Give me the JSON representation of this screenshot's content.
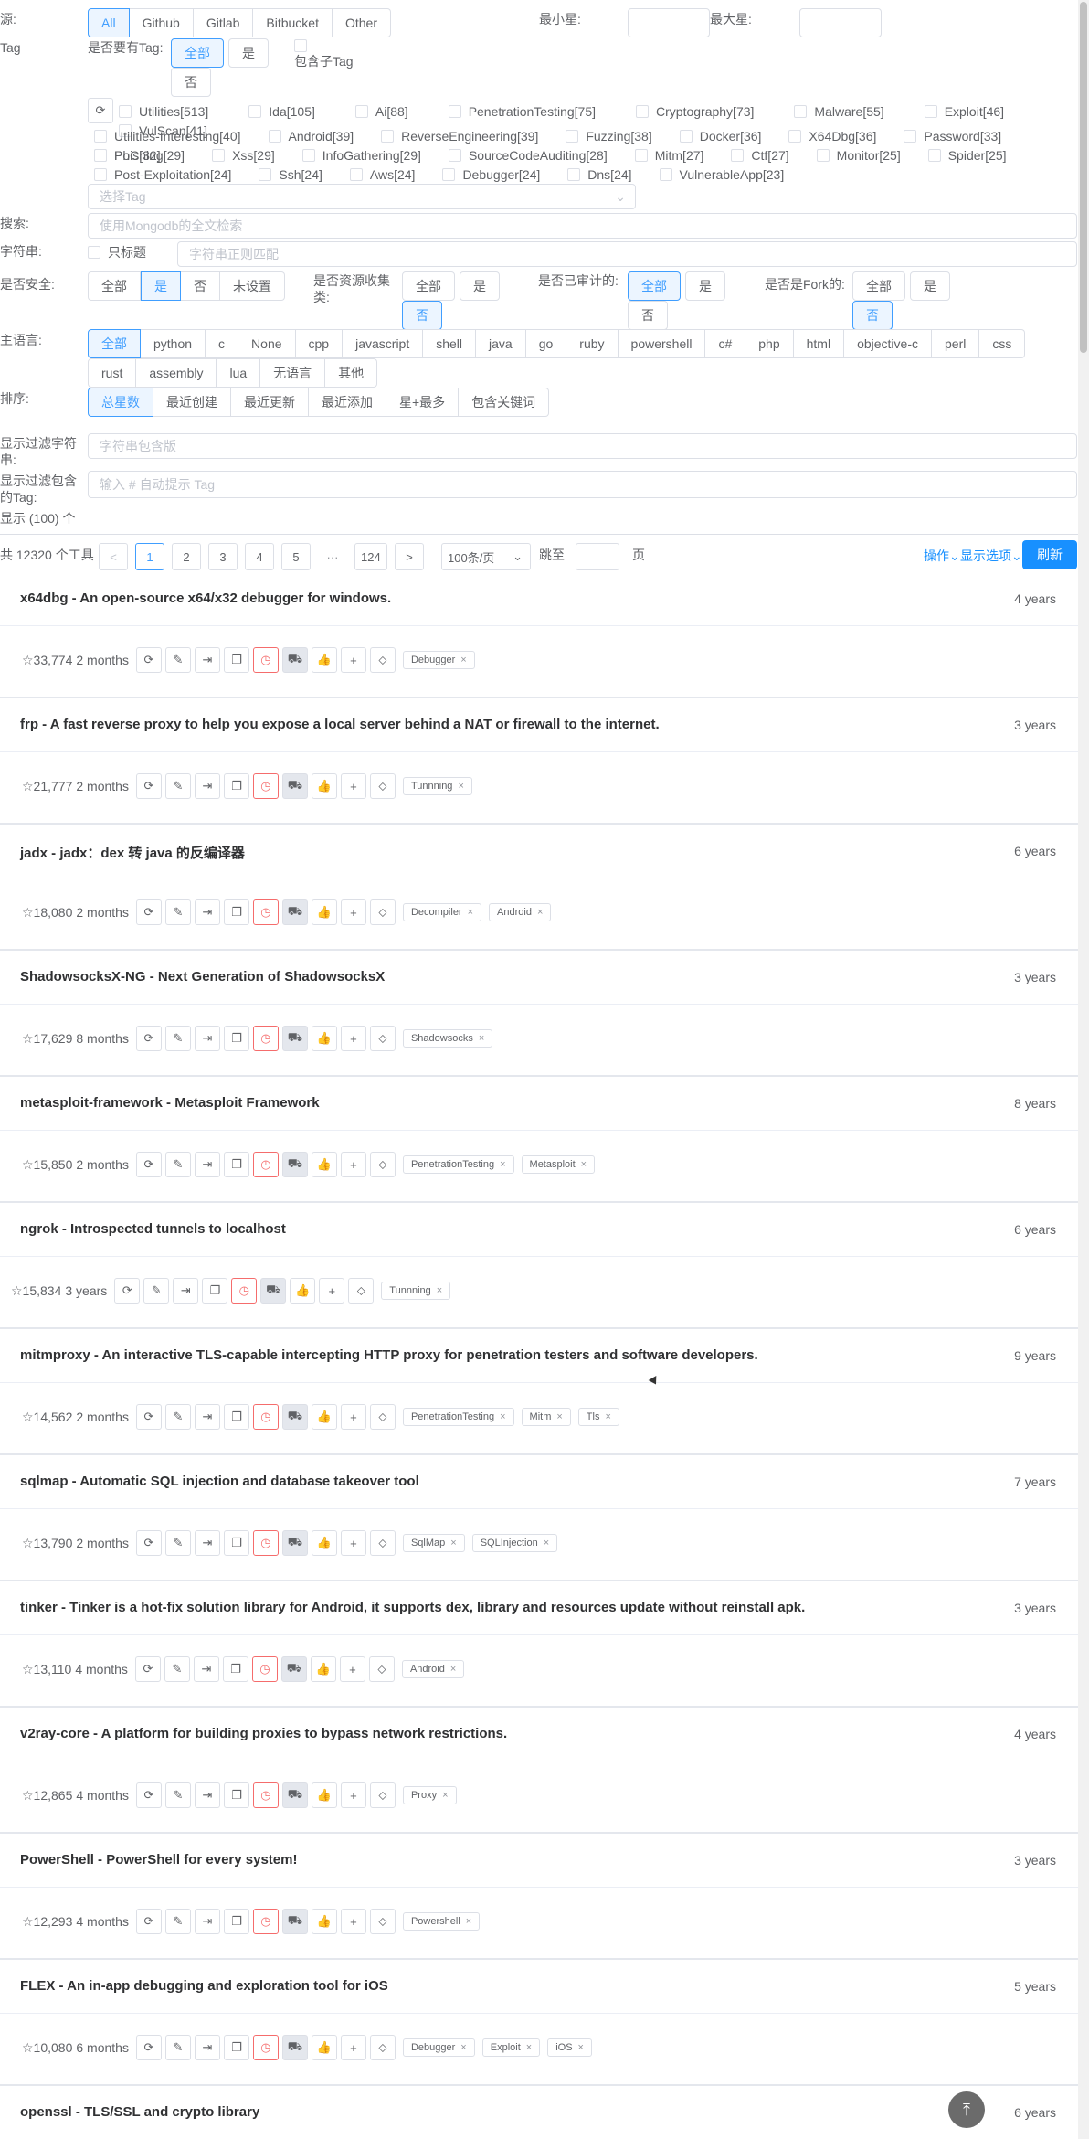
{
  "filters": {
    "source_label": "源:",
    "source_options": [
      "All",
      "Github",
      "Gitlab",
      "Bitbucket",
      "Other"
    ],
    "min_star_label": "最小星:",
    "max_star_label": "最大星:",
    "tag_label": "Tag",
    "has_tag_label": "是否要有Tag:",
    "has_tag_options": [
      "全部",
      "是",
      "否"
    ],
    "include_sub_label": "包含子Tag",
    "tags_row1": [
      "Utilities[513]",
      "Ida[105]",
      "Ai[88]",
      "PenetrationTesting[75]",
      "Cryptography[73]",
      "Malware[55]",
      "Exploit[46]",
      "VulScan[41]"
    ],
    "tags_row2": [
      "Utilities-Interesting[40]",
      "Android[39]",
      "ReverseEngineering[39]",
      "Fuzzing[38]",
      "Docker[36]",
      "X64Dbg[36]",
      "Password[33]",
      "PoC[32]"
    ],
    "tags_row3": [
      "Phishing[29]",
      "Xss[29]",
      "InfoGathering[29]",
      "SourceCodeAuditing[28]",
      "Mitm[27]",
      "Ctf[27]",
      "Monitor[25]",
      "Spider[25]"
    ],
    "tags_row4": [
      "Post-Exploitation[24]",
      "Ssh[24]",
      "Aws[24]",
      "Debugger[24]",
      "Dns[24]",
      "VulnerableApp[23]"
    ],
    "select_tag_placeholder": "选择Tag",
    "search_label": "搜索:",
    "search_placeholder": "使用Mongodb的全文检索",
    "string_label": "字符串:",
    "title_only_label": "只标题",
    "regex_placeholder": "字符串正则匹配",
    "safe_label": "是否安全:",
    "safe_options": [
      "全部",
      "是",
      "否",
      "未设置"
    ],
    "collect_label": "是否资源收集类:",
    "collect_options": [
      "全部",
      "是",
      "否"
    ],
    "audited_label": "是否已审计的:",
    "audited_options": [
      "全部",
      "是",
      "否"
    ],
    "fork_label": "是否是Fork的:",
    "fork_options": [
      "全部",
      "是",
      "否"
    ],
    "lang_label": "主语言:",
    "lang_row1": [
      "全部",
      "python",
      "c",
      "None",
      "cpp",
      "javascript",
      "shell",
      "java",
      "go",
      "ruby",
      "powershell",
      "c#",
      "php",
      "html",
      "objective-c",
      "perl",
      "css"
    ],
    "lang_row2": [
      "rust",
      "assembly",
      "lua",
      "无语言",
      "其他"
    ],
    "sort_label": "排序:",
    "sort_options": [
      "总星数",
      "最近创建",
      "最近更新",
      "最近添加",
      "星+最多",
      "包含关键词"
    ],
    "show_filter_label": "显示过滤字符串:",
    "show_filter_placeholder": "字符串包含版",
    "show_tag_label": "显示过滤包含的Tag:",
    "show_tag_placeholder": "输入 # 自动提示 Tag",
    "show_count": "显示 (100) 个"
  },
  "pager": {
    "total": "共 12320 个工具",
    "prev": "<",
    "pages": [
      "1",
      "2",
      "3",
      "4",
      "5"
    ],
    "ellipsis": "···",
    "last": "124",
    "next": ">",
    "per_page": "100条/页",
    "goto": "跳至",
    "page_unit": "页",
    "ops": "操作",
    "display": "显示选项",
    "refresh": "刷新"
  },
  "repos": [
    {
      "title": "x64dbg - An open-source x64/x32 debugger for windows.",
      "age": "4 years",
      "stars": "☆33,774",
      "since": "2 months",
      "tags": [
        "Debugger"
      ]
    },
    {
      "title": "frp - A fast reverse proxy to help you expose a local server behind a NAT or firewall to the internet.",
      "age": "3 years",
      "stars": "☆21,777",
      "since": "2 months",
      "tags": [
        "Tunnning"
      ]
    },
    {
      "title": "jadx - jadx：dex 转 java 的反编译器",
      "age": "6 years",
      "stars": "☆18,080",
      "since": "2 months",
      "tags": [
        "Decompiler",
        "Android"
      ]
    },
    {
      "title": "ShadowsocksX-NG - Next Generation of ShadowsocksX",
      "age": "3 years",
      "stars": "☆17,629",
      "since": "8 months",
      "tags": [
        "Shadowsocks"
      ]
    },
    {
      "title": "metasploit-framework - Metasploit Framework",
      "age": "8 years",
      "stars": "☆15,850",
      "since": "2 months",
      "tags": [
        "PenetrationTesting",
        "Metasploit"
      ]
    },
    {
      "title": "ngrok - Introspected tunnels to localhost",
      "age": "6 years",
      "stars": "☆15,834",
      "since": "3 years",
      "tags": [
        "Tunnning"
      ]
    },
    {
      "title": "mitmproxy - An interactive TLS-capable intercepting HTTP proxy for penetration testers and software developers.",
      "age": "9 years",
      "stars": "☆14,562",
      "since": "2 months",
      "tags": [
        "PenetrationTesting",
        "Mitm",
        "Tls"
      ]
    },
    {
      "title": "sqlmap - Automatic SQL injection and database takeover tool",
      "age": "7 years",
      "stars": "☆13,790",
      "since": "2 months",
      "tags": [
        "SqlMap",
        "SQLInjection"
      ]
    },
    {
      "title": "tinker - Tinker is a hot-fix solution library for Android, it supports dex, library and resources update without reinstall apk.",
      "age": "3 years",
      "stars": "☆13,110",
      "since": "4 months",
      "tags": [
        "Android"
      ]
    },
    {
      "title": "v2ray-core - A platform for building proxies to bypass network restrictions.",
      "age": "4 years",
      "stars": "☆12,865",
      "since": "4 months",
      "tags": [
        "Proxy"
      ]
    },
    {
      "title": "PowerShell - PowerShell for every system!",
      "age": "3 years",
      "stars": "☆12,293",
      "since": "4 months",
      "tags": [
        "Powershell"
      ]
    },
    {
      "title": "FLEX - An in-app debugging and exploration tool for iOS",
      "age": "5 years",
      "stars": "☆10,080",
      "since": "6 months",
      "tags": [
        "Debugger",
        "Exploit",
        "iOS"
      ]
    },
    {
      "title": "openssl - TLS/SSL and crypto library",
      "age": "6 years",
      "stars": "",
      "since": "",
      "tags": []
    }
  ],
  "icons": [
    "refresh-icon",
    "edit-icon",
    "jump-icon",
    "copy-icon",
    "audit-icon",
    "cart-icon",
    "like-icon",
    "add-icon",
    "tag-icon"
  ],
  "colors": {
    "accent": "#409eff",
    "primary_button": "#1890ff",
    "danger": "#f56c6c"
  }
}
